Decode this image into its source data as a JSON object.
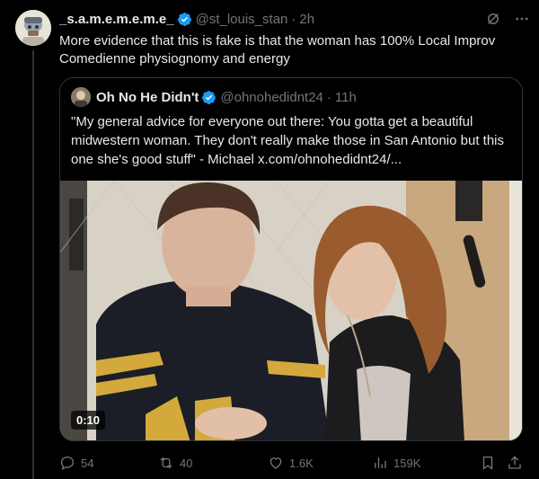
{
  "tweet": {
    "display_name": "_s.a.m.e.m.e.m.e_",
    "handle": "@st_louis_stan",
    "time": "2h",
    "text": "More evidence that this is fake is that the woman has 100% Local Improv Comedienne physiognomy and energy",
    "avatar_icon": "avatar-icon",
    "verified_icon": "verified-badge-icon",
    "header_icons": [
      "grok-icon",
      "more-options-icon"
    ]
  },
  "quote": {
    "display_name": "Oh No He Didn't",
    "handle": "@ohnohedidnt24",
    "time": "11h",
    "text": "\"My general advice for everyone out there: You gotta get a beautiful midwestern woman. They don't really make those in San Antonio but this one she's good stuff\" - Michael  x.com/ohnohedidnt24/...",
    "video_duration": "0:10"
  },
  "actions": {
    "replies": "54",
    "retweets": "40",
    "likes": "1.6K",
    "views": "159K"
  },
  "colors": {
    "background": "#000000",
    "text": "#e7e9ea",
    "muted": "#71767b",
    "border": "#2f3336",
    "verified": "#1d9bf0"
  }
}
